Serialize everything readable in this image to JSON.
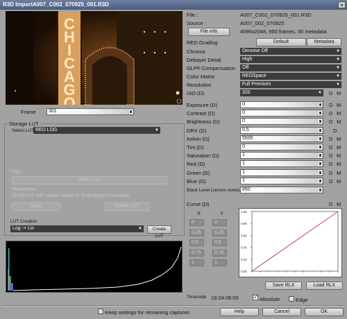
{
  "window": {
    "title": "R3D ImportA007_C002_070925_001.R3D",
    "close_glyph": "×"
  },
  "preview": {
    "sign_text": "CHICAGO"
  },
  "frame": {
    "label": "Frame",
    "value": "301"
  },
  "storage_lut": {
    "group_label": "Storage LUT",
    "select_label": "Select LUT",
    "selected": "RED LOG",
    "file_label": "File",
    "file_value": "RED LOG",
    "properties_label": "Properties",
    "properties_text": "16-bit LUT with output values in floating point precision",
    "reset_label": "Reset",
    "delete_label": "Delete LUT"
  },
  "lut_creation": {
    "label": "LUT Creation",
    "selected": "Log -> Lin",
    "create_label": "Create LUT"
  },
  "info": {
    "file_label": "File :",
    "file_value": "A007_C002_070925_001.R3D",
    "source_label": "Source :",
    "source_value": "A007_002_070925",
    "file_info_button": "File info",
    "file_info_value": "4096x2048, 950 frames, 30 metadata"
  },
  "grading": {
    "label": "RED Grading",
    "default_button": "Default",
    "metadata_button": "Metadata",
    "dropdowns": [
      {
        "label": "Chroma",
        "value": "Denoise Off"
      },
      {
        "label": "Debayer Detail",
        "value": "High"
      },
      {
        "label": "OLPF Compensation",
        "value": "Off"
      },
      {
        "label": "Color Matrix",
        "value": "REDSpace"
      },
      {
        "label": "Resolution",
        "value": "Full Premium"
      },
      {
        "label": "ISO (D)",
        "value": "320"
      }
    ],
    "sliders": [
      {
        "label": "Exposure (D)",
        "value": "0",
        "fill": 0.5
      },
      {
        "label": "Contrast (D)",
        "value": "0",
        "fill": 0.5
      },
      {
        "label": "Brightness (D)",
        "value": "0",
        "fill": 0.5
      },
      {
        "label": "DRX (D)",
        "value": "0.5",
        "fill": 0.5
      },
      {
        "label": "Kelvin (D)",
        "value": "5500",
        "fill": 0.5
      },
      {
        "label": "Tint (D)",
        "value": "0",
        "fill": 0.5
      },
      {
        "label": "Saturation (D)",
        "value": "1",
        "fill": 0.5
      },
      {
        "label": "Red (D)",
        "value": "1",
        "fill": 0.5
      },
      {
        "label": "Green (D)",
        "value": "1",
        "fill": 0.5
      },
      {
        "label": "Blue (D)",
        "value": "1",
        "fill": 0.5
      }
    ],
    "black_level": {
      "label": "Black Level (sensor noise)",
      "value": "850"
    },
    "d_label": "D",
    "m_label": "M"
  },
  "curve": {
    "label": "Curve (D)",
    "x_header": "X",
    "y_header": "Y",
    "points": [
      [
        "0",
        "0"
      ],
      [
        "0.25",
        "0.25"
      ],
      [
        "0.5",
        "0.5"
      ],
      [
        "0.75",
        "0.75"
      ],
      [
        "1",
        "1"
      ]
    ],
    "ticks": [
      "1.00",
      "0.80",
      "0.60",
      "0.40",
      "0.20",
      "0.00"
    ]
  },
  "footer": {
    "save_rlx": "Save RLX",
    "load_rlx": "Load RLX",
    "timecode_label": "Timecode",
    "timecode_value": "19:24:08:00",
    "absolute_label": "Absolute",
    "edge_label": "Edge",
    "keep_label": "Keep settings for remaining captures",
    "help": "Help",
    "cancel": "Cancel",
    "ok": "OK"
  },
  "colors": {
    "titlebar": "#4c5c7e",
    "dropdown": "#3c3c3c",
    "curve_line": "#c04040",
    "histogram_line": "#ffffff"
  }
}
